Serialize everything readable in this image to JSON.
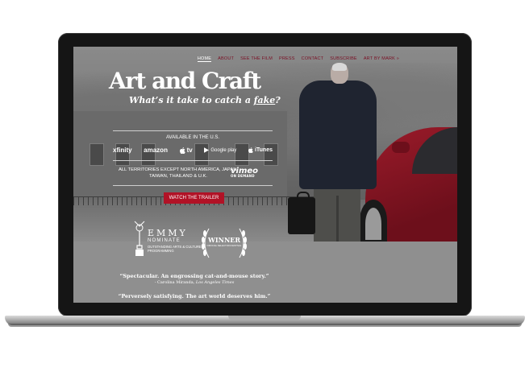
{
  "nav": {
    "items": [
      "HOME",
      "ABOUT",
      "SEE THE FILM",
      "PRESS",
      "CONTACT",
      "SUBSCRIBE",
      "ART BY MARK »"
    ],
    "active": "HOME",
    "link_color": "#7a0f24"
  },
  "hero": {
    "title": "Art and Craft",
    "subtitle_prefix": "What’s it take to catch a ",
    "subtitle_emphasis": "fake",
    "subtitle_suffix": "?",
    "available_label": "AVAILABLE IN THE U.S.",
    "platforms": [
      {
        "name": "xfinity",
        "icon": "xfinity-logo"
      },
      {
        "name": "amazon",
        "icon": "amazon-logo"
      },
      {
        "name": "tv",
        "icon": "apple-tv-logo"
      },
      {
        "name": "Google play",
        "icon": "google-play-logo"
      },
      {
        "name": "iTunes",
        "icon": "itunes-logo"
      }
    ],
    "territories": "ALL TERRITORIES EXCEPT NORTH AMERICA, JAPAN, TAIWAN, THAILAND & U.K.",
    "vimeo": {
      "logo": "vimeo",
      "tagline": "ON DEMAND"
    },
    "trailer_button": "WATCH THE TRAILER",
    "accent_color": "#b11226"
  },
  "awards": {
    "emmy": {
      "word": "EMMY",
      "status": "NOMINATE",
      "category": "OUTSTANDING ARTS & CULTURE PROGRAMMING",
      "icon": "emmy-statue-icon"
    },
    "winner": {
      "label": "WINNER",
      "festival": "OFFICIAL SELECTION FESTIVAL",
      "icon": "laurel-wreath-icon"
    }
  },
  "quotes": [
    {
      "text": "“Spectacular. An engrossing cat-and-mouse story.”",
      "source_name": "- Carolina Miranda, ",
      "source_pub": "Los Angeles Times"
    },
    {
      "text": "“Perversely satisfying. The art world deserves him.”"
    }
  ]
}
